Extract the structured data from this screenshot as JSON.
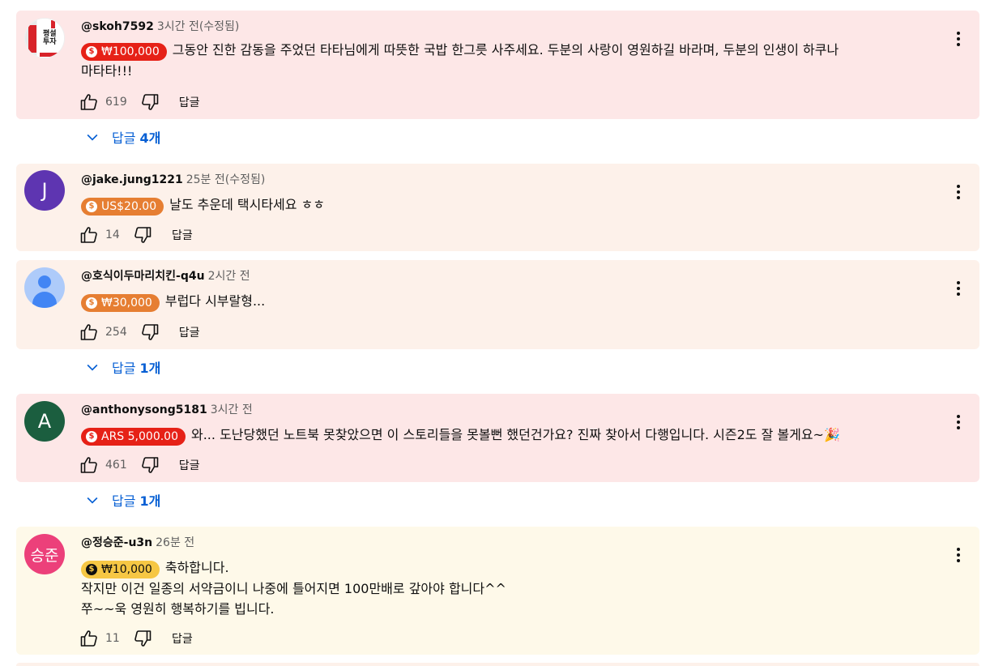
{
  "comments": [
    {
      "author": "@skoh7592",
      "time": "3시간 전(수정됨)",
      "amount": "₩100,000",
      "text_line1": "그동안 진한 감동을 주었던 타타님에게 따뜻한 국밥 한그릇 사주세요. 두분의 사랑이 영원하길 바라며, 두분의 인생이 하쿠나",
      "text_line2": "마타타!!!",
      "avatar_text": "평설 투자",
      "likes": "619",
      "reply_label": "답글",
      "replies_label": "답글",
      "replies_count": "4개",
      "color": "#fde7e7"
    },
    {
      "author": "@jake.jung1221",
      "time": "25분 전(수정됨)",
      "amount": "US$20.00",
      "text_line1": "날도 추운데 택시타세요 ㅎㅎ",
      "avatar_text": "J",
      "likes": "14",
      "reply_label": "답글",
      "color": "#fdf1ea"
    },
    {
      "author": "@호식이두마리치킨-q4u",
      "time": "2시간 전",
      "amount": "₩30,000",
      "text_line1": "부럽다 시부랄형...",
      "likes": "254",
      "reply_label": "답글",
      "replies_label": "답글",
      "replies_count": "1개",
      "color": "#fdf1ea"
    },
    {
      "author": "@anthonysong5181",
      "time": "3시간 전",
      "amount": "ARS 5,000.00",
      "text_line1": "와... 도난당했던 노트북 못찾았으면 이 스토리들을 못볼뻔 했던건가요? 진짜 찾아서 다행입니다. 시즌2도 잘 볼게요~🎉",
      "avatar_text": "A",
      "likes": "461",
      "reply_label": "답글",
      "replies_label": "답글",
      "replies_count": "1개",
      "color": "#fde7e7"
    },
    {
      "author": "@정승준-u3n",
      "time": "26분 전",
      "amount": "₩10,000",
      "text_line1": "축하합니다.",
      "text_line2": "작지만 이건 일종의 서약금이니 나중에 틀어지면 100만배로 갚아야 합니다^^",
      "text_line3": "쭈~~욱 영원히 행복하기를 빕니다.",
      "avatar_text": "승준",
      "likes": "11",
      "reply_label": "답글",
      "color": "#fef9e9"
    }
  ],
  "chip_colors": {
    "red": "#e62117",
    "orange": "#e67e32",
    "amber": "#f6c744"
  },
  "link_color": "#065fd4",
  "icons": [
    "thumbs-up-icon",
    "thumbs-down-icon",
    "more-vert-icon",
    "chevron-down-icon",
    "super-thanks-icon"
  ]
}
